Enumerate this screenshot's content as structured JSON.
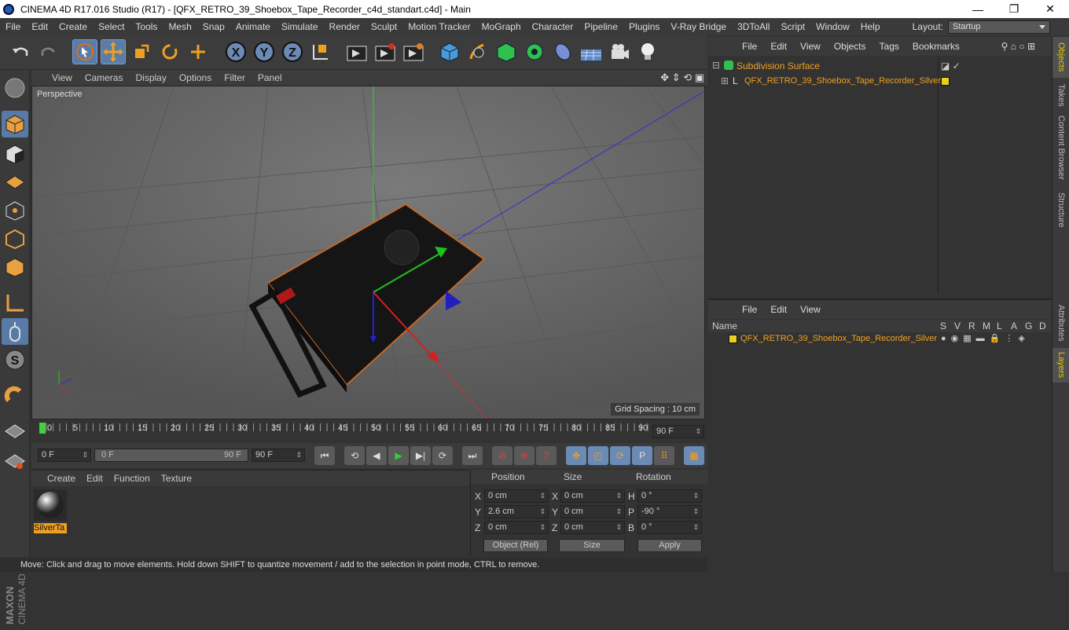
{
  "title": "CINEMA 4D R17.016 Studio (R17) - [QFX_RETRO_39_Shoebox_Tape_Recorder_c4d_standart.c4d] - Main",
  "menu": [
    "File",
    "Edit",
    "Create",
    "Select",
    "Tools",
    "Mesh",
    "Snap",
    "Animate",
    "Simulate",
    "Render",
    "Sculpt",
    "Motion Tracker",
    "MoGraph",
    "Character",
    "Pipeline",
    "Plugins",
    "V-Ray Bridge",
    "3DToAll",
    "Script",
    "Window",
    "Help"
  ],
  "layout": {
    "label": "Layout:",
    "value": "Startup"
  },
  "viewport": {
    "menu": [
      "View",
      "Cameras",
      "Display",
      "Options",
      "Filter",
      "Panel"
    ],
    "camera": "Perspective",
    "grid_spacing": "Grid Spacing : 10 cm"
  },
  "timeline": {
    "ticks": [
      "0",
      "5",
      "10",
      "15",
      "20",
      "25",
      "30",
      "35",
      "40",
      "45",
      "50",
      "55",
      "60",
      "65",
      "70",
      "75",
      "80",
      "85",
      "90"
    ],
    "current_frame": "90 F"
  },
  "transport": {
    "start": "0 F",
    "range_start": "0 F",
    "range_end": "90 F",
    "end": "90 F"
  },
  "materials": {
    "menu": [
      "Create",
      "Edit",
      "Function",
      "Texture"
    ],
    "items": [
      {
        "name": "SilverTa"
      }
    ]
  },
  "coords": {
    "headers": [
      "Position",
      "Size",
      "Rotation"
    ],
    "rows": [
      {
        "axis": "X",
        "pos": "0 cm",
        "size_axis": "X",
        "size": "0 cm",
        "rot_axis": "H",
        "rot": "0 °"
      },
      {
        "axis": "Y",
        "pos": "2.6 cm",
        "size_axis": "Y",
        "size": "0 cm",
        "rot_axis": "P",
        "rot": "-90 °"
      },
      {
        "axis": "Z",
        "pos": "0 cm",
        "size_axis": "Z",
        "size": "0 cm",
        "rot_axis": "B",
        "rot": "0 °"
      }
    ],
    "mode": "Object (Rel)",
    "size_mode": "Size",
    "apply": "Apply"
  },
  "objects": {
    "menu": [
      "File",
      "Edit",
      "View",
      "Objects",
      "Tags",
      "Bookmarks"
    ],
    "items": [
      {
        "name": "Subdivision Surface"
      },
      {
        "name": "QFX_RETRO_39_Shoebox_Tape_Recorder_Silver"
      }
    ]
  },
  "layers": {
    "menu": [
      "File",
      "Edit",
      "View"
    ],
    "col_name": "Name",
    "cols": [
      "S",
      "V",
      "R",
      "M",
      "L",
      "A",
      "G",
      "D"
    ],
    "items": [
      {
        "name": "QFX_RETRO_39_Shoebox_Tape_Recorder_Silver"
      }
    ]
  },
  "right_tabs": [
    "Objects",
    "Takes",
    "Content Browser",
    "Structure",
    "Attributes",
    "Layers"
  ],
  "status": "Move: Click and drag to move elements. Hold down SHIFT to quantize movement / add to the selection in point mode, CTRL to remove.",
  "colors": {
    "accent": "#f0a020",
    "selected_tool": "#587aa6",
    "layer_color": "#e8d020"
  }
}
